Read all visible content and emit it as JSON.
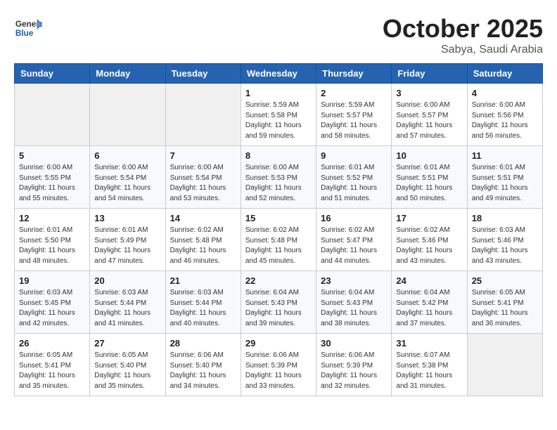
{
  "header": {
    "logo": {
      "general": "General",
      "blue": "Blue"
    },
    "month": "October 2025",
    "location": "Sabya, Saudi Arabia"
  },
  "weekdays": [
    "Sunday",
    "Monday",
    "Tuesday",
    "Wednesday",
    "Thursday",
    "Friday",
    "Saturday"
  ],
  "weeks": [
    [
      {
        "day": "",
        "info": ""
      },
      {
        "day": "",
        "info": ""
      },
      {
        "day": "",
        "info": ""
      },
      {
        "day": "1",
        "info": "Sunrise: 5:59 AM\nSunset: 5:58 PM\nDaylight: 11 hours\nand 59 minutes."
      },
      {
        "day": "2",
        "info": "Sunrise: 5:59 AM\nSunset: 5:57 PM\nDaylight: 11 hours\nand 58 minutes."
      },
      {
        "day": "3",
        "info": "Sunrise: 6:00 AM\nSunset: 5:57 PM\nDaylight: 11 hours\nand 57 minutes."
      },
      {
        "day": "4",
        "info": "Sunrise: 6:00 AM\nSunset: 5:56 PM\nDaylight: 11 hours\nand 56 minutes."
      }
    ],
    [
      {
        "day": "5",
        "info": "Sunrise: 6:00 AM\nSunset: 5:55 PM\nDaylight: 11 hours\nand 55 minutes."
      },
      {
        "day": "6",
        "info": "Sunrise: 6:00 AM\nSunset: 5:54 PM\nDaylight: 11 hours\nand 54 minutes."
      },
      {
        "day": "7",
        "info": "Sunrise: 6:00 AM\nSunset: 5:54 PM\nDaylight: 11 hours\nand 53 minutes."
      },
      {
        "day": "8",
        "info": "Sunrise: 6:00 AM\nSunset: 5:53 PM\nDaylight: 11 hours\nand 52 minutes."
      },
      {
        "day": "9",
        "info": "Sunrise: 6:01 AM\nSunset: 5:52 PM\nDaylight: 11 hours\nand 51 minutes."
      },
      {
        "day": "10",
        "info": "Sunrise: 6:01 AM\nSunset: 5:51 PM\nDaylight: 11 hours\nand 50 minutes."
      },
      {
        "day": "11",
        "info": "Sunrise: 6:01 AM\nSunset: 5:51 PM\nDaylight: 11 hours\nand 49 minutes."
      }
    ],
    [
      {
        "day": "12",
        "info": "Sunrise: 6:01 AM\nSunset: 5:50 PM\nDaylight: 11 hours\nand 48 minutes."
      },
      {
        "day": "13",
        "info": "Sunrise: 6:01 AM\nSunset: 5:49 PM\nDaylight: 11 hours\nand 47 minutes."
      },
      {
        "day": "14",
        "info": "Sunrise: 6:02 AM\nSunset: 5:48 PM\nDaylight: 11 hours\nand 46 minutes."
      },
      {
        "day": "15",
        "info": "Sunrise: 6:02 AM\nSunset: 5:48 PM\nDaylight: 11 hours\nand 45 minutes."
      },
      {
        "day": "16",
        "info": "Sunrise: 6:02 AM\nSunset: 5:47 PM\nDaylight: 11 hours\nand 44 minutes."
      },
      {
        "day": "17",
        "info": "Sunrise: 6:02 AM\nSunset: 5:46 PM\nDaylight: 11 hours\nand 43 minutes."
      },
      {
        "day": "18",
        "info": "Sunrise: 6:03 AM\nSunset: 5:46 PM\nDaylight: 11 hours\nand 43 minutes."
      }
    ],
    [
      {
        "day": "19",
        "info": "Sunrise: 6:03 AM\nSunset: 5:45 PM\nDaylight: 11 hours\nand 42 minutes."
      },
      {
        "day": "20",
        "info": "Sunrise: 6:03 AM\nSunset: 5:44 PM\nDaylight: 11 hours\nand 41 minutes."
      },
      {
        "day": "21",
        "info": "Sunrise: 6:03 AM\nSunset: 5:44 PM\nDaylight: 11 hours\nand 40 minutes."
      },
      {
        "day": "22",
        "info": "Sunrise: 6:04 AM\nSunset: 5:43 PM\nDaylight: 11 hours\nand 39 minutes."
      },
      {
        "day": "23",
        "info": "Sunrise: 6:04 AM\nSunset: 5:43 PM\nDaylight: 11 hours\nand 38 minutes."
      },
      {
        "day": "24",
        "info": "Sunrise: 6:04 AM\nSunset: 5:42 PM\nDaylight: 11 hours\nand 37 minutes."
      },
      {
        "day": "25",
        "info": "Sunrise: 6:05 AM\nSunset: 5:41 PM\nDaylight: 11 hours\nand 36 minutes."
      }
    ],
    [
      {
        "day": "26",
        "info": "Sunrise: 6:05 AM\nSunset: 5:41 PM\nDaylight: 11 hours\nand 35 minutes."
      },
      {
        "day": "27",
        "info": "Sunrise: 6:05 AM\nSunset: 5:40 PM\nDaylight: 11 hours\nand 35 minutes."
      },
      {
        "day": "28",
        "info": "Sunrise: 6:06 AM\nSunset: 5:40 PM\nDaylight: 11 hours\nand 34 minutes."
      },
      {
        "day": "29",
        "info": "Sunrise: 6:06 AM\nSunset: 5:39 PM\nDaylight: 11 hours\nand 33 minutes."
      },
      {
        "day": "30",
        "info": "Sunrise: 6:06 AM\nSunset: 5:39 PM\nDaylight: 11 hours\nand 32 minutes."
      },
      {
        "day": "31",
        "info": "Sunrise: 6:07 AM\nSunset: 5:38 PM\nDaylight: 11 hours\nand 31 minutes."
      },
      {
        "day": "",
        "info": ""
      }
    ]
  ]
}
